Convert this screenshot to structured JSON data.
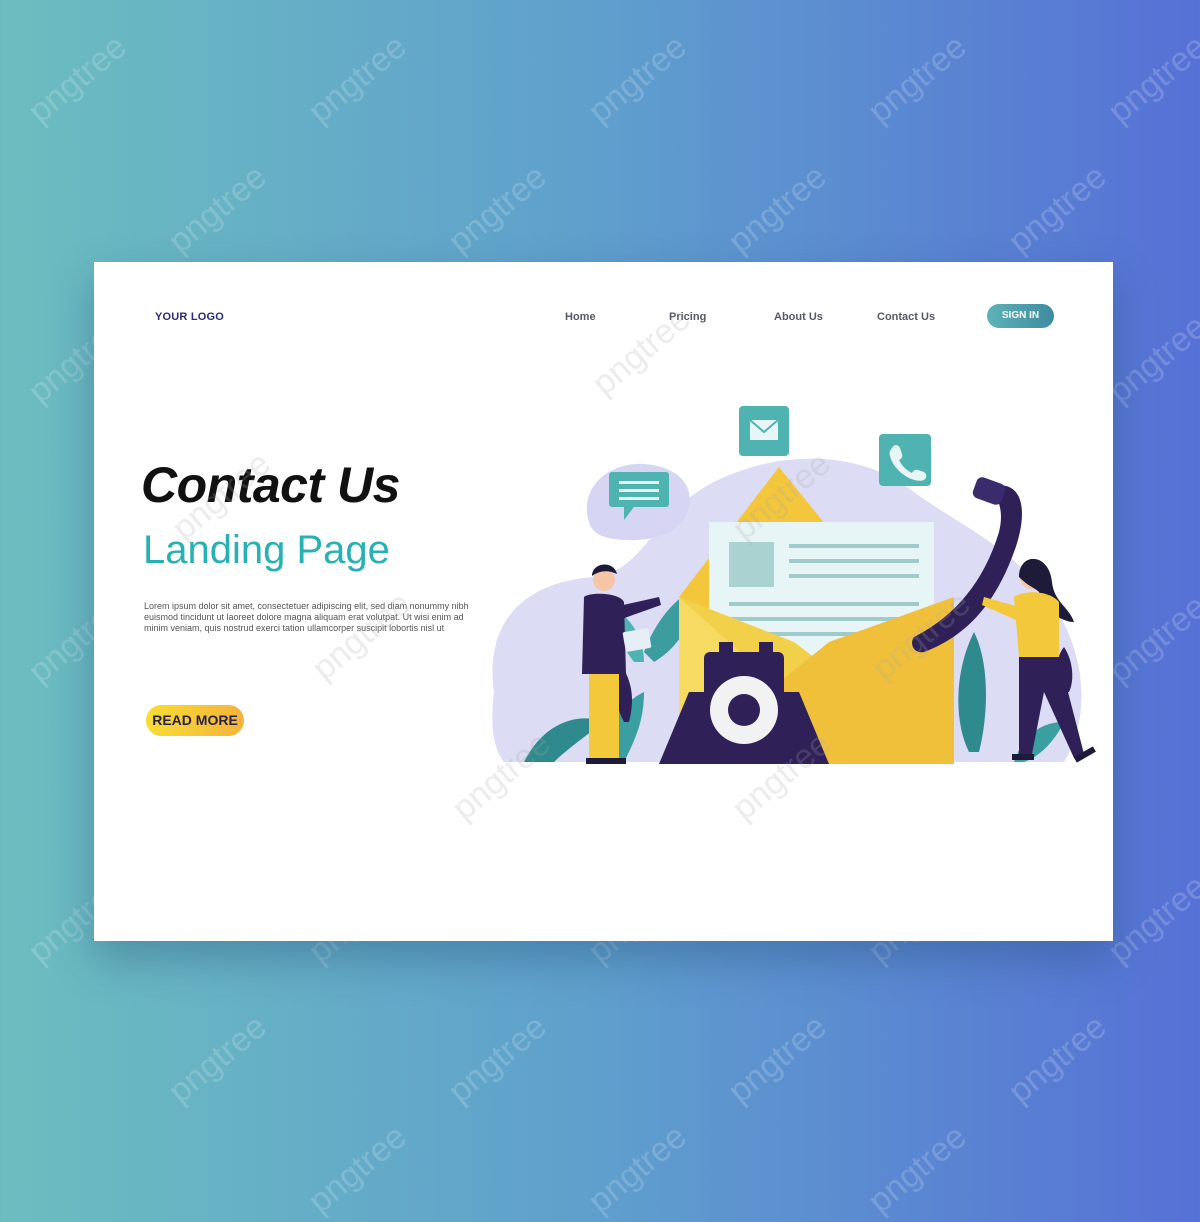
{
  "header": {
    "logo": "YOUR LOGO",
    "nav": [
      "Home",
      "Pricing",
      "About Us",
      "Contact Us"
    ],
    "signin_label": "SIGN IN"
  },
  "hero": {
    "title": "Contact Us",
    "subtitle": "Landing Page",
    "body": "Lorem ipsum dolor sit amet, consectetuer adipiscing elit, sed diam nonummy nibh euismod tincidunt ut laoreet dolore magna aliquam erat volutpat. Ut wisi enim ad minim veniam, quis nostrud exerci tation ullamcorper suscipit lobortis nisl ut",
    "cta_label": "READ MORE"
  },
  "watermark": "pngtree",
  "colors": {
    "accent": "#27b1b4",
    "cta": "#f7dd34",
    "dark_purple": "#2f2157",
    "yellow": "#f3c83b"
  },
  "illustration": {
    "icons": [
      "chat-icon",
      "mail-icon",
      "phone-icon"
    ]
  }
}
